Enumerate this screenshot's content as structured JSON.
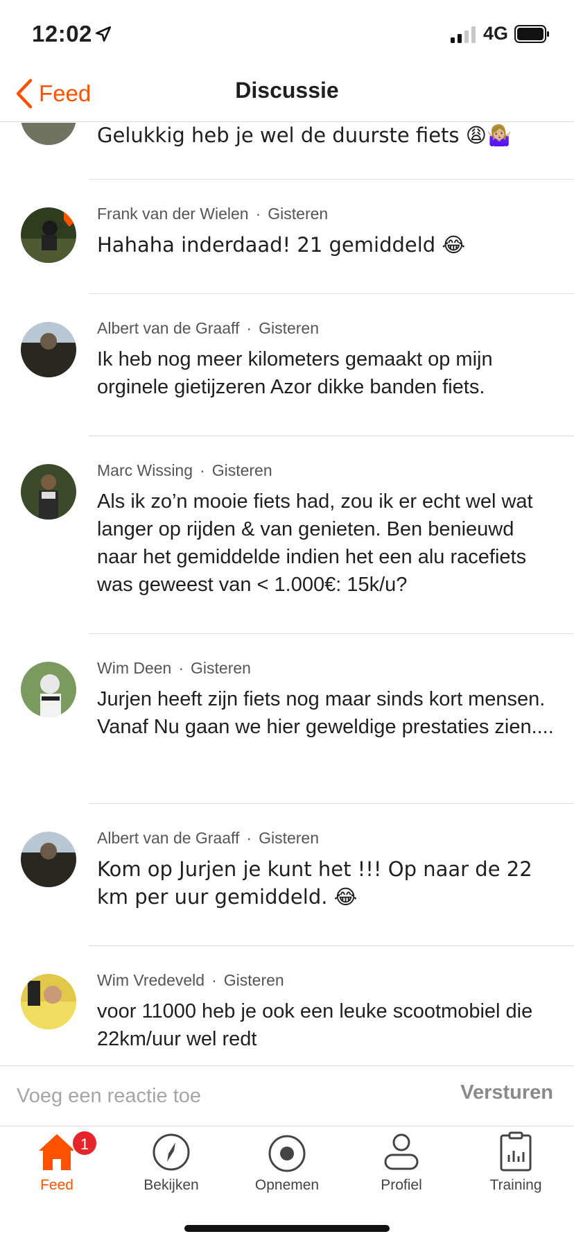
{
  "status_bar": {
    "time": "12:02",
    "network": "4G"
  },
  "nav": {
    "back_label": "Feed",
    "title": "Discussie"
  },
  "partial_comment": {
    "text": "Gelukkig heb je wel de duurste fiets 😩🤷🏼‍♀️"
  },
  "comments": [
    {
      "author": "Frank van der Wielen",
      "time": "Gisteren",
      "text": "Hahaha inderdaad! 21 gemiddeld 😂"
    },
    {
      "author": "Albert van de Graaff",
      "time": "Gisteren",
      "text": "Ik heb nog meer kilometers gemaakt op mijn orginele gietijzeren Azor dikke banden fiets."
    },
    {
      "author": "Marc Wissing",
      "time": "Gisteren",
      "text": "Als ik zo’n mooie fiets had, zou ik er echt wel wat langer op rijden & van genieten. Ben benieuwd naar het gemiddelde indien het een alu racefiets was geweest van < 1.000€: 15k/u?"
    },
    {
      "author": "Wim Deen",
      "time": "Gisteren",
      "text": "Jurjen heeft zijn fiets nog maar sinds kort mensen. Vanaf Nu gaan we hier geweldige prestaties zien...."
    },
    {
      "author": "Albert van de Graaff",
      "time": "Gisteren",
      "text": "Kom op Jurjen je kunt het !!! Op naar de 22 km per uur gemiddeld. 😂"
    },
    {
      "author": "Wim Vredeveld",
      "time": "Gisteren",
      "text": "voor  11000 heb je ook een leuke scootmobiel die 22km/uur wel redt"
    }
  ],
  "composer": {
    "placeholder": "Voeg een reactie toe",
    "send_label": "Versturen"
  },
  "tabs": [
    {
      "label": "Feed",
      "icon": "home-icon",
      "badge": "1"
    },
    {
      "label": "Bekijken",
      "icon": "compass-icon"
    },
    {
      "label": "Opnemen",
      "icon": "record-icon"
    },
    {
      "label": "Profiel",
      "icon": "profile-icon"
    },
    {
      "label": "Training",
      "icon": "training-icon"
    }
  ],
  "colors": {
    "accent": "#fc5200",
    "badge": "#e5252a"
  }
}
